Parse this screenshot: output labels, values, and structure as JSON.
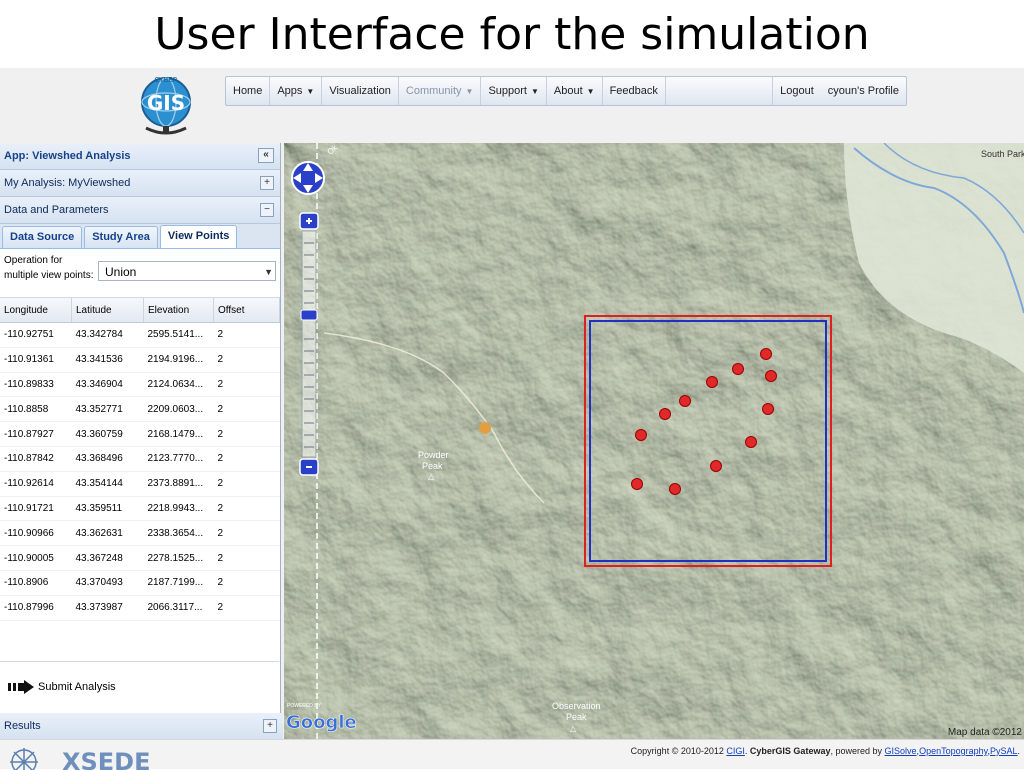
{
  "slide": {
    "title": "User Interface for the simulation"
  },
  "logo": {
    "text": "GIS",
    "arc_text": "CYBER"
  },
  "navbar": {
    "items": [
      {
        "label": "Home",
        "dropdown": false,
        "muted": false
      },
      {
        "label": "Apps",
        "dropdown": true,
        "muted": false
      },
      {
        "label": "Visualization",
        "dropdown": false,
        "muted": false
      },
      {
        "label": "Community",
        "dropdown": true,
        "muted": true
      },
      {
        "label": "Support",
        "dropdown": true,
        "muted": false
      },
      {
        "label": "About",
        "dropdown": true,
        "muted": false
      },
      {
        "label": "Feedback",
        "dropdown": false,
        "muted": false
      }
    ],
    "logout": "Logout",
    "profile": "cyoun's Profile"
  },
  "panel": {
    "app_title": "App: Viewshed Analysis",
    "collapse_icon": "«",
    "my_analysis": "My Analysis: MyViewshed",
    "expand_icon": "+",
    "data_params": "Data and Parameters",
    "minus_icon": "−",
    "tabs": [
      {
        "label": "Data Source",
        "active": false
      },
      {
        "label": "Study Area",
        "active": false
      },
      {
        "label": "View Points",
        "active": true
      }
    ],
    "operation_label": "Operation for multiple view points:",
    "operation_value": "Union",
    "columns": [
      "Longitude",
      "Latitude",
      "Elevation",
      "Offset"
    ],
    "rows": [
      [
        "-110.92751",
        "43.342784",
        "2595.5141...",
        "2"
      ],
      [
        "-110.91361",
        "43.341536",
        "2194.9196...",
        "2"
      ],
      [
        "-110.89833",
        "43.346904",
        "2124.0634...",
        "2"
      ],
      [
        "-110.8858",
        "43.352771",
        "2209.0603...",
        "2"
      ],
      [
        "-110.87927",
        "43.360759",
        "2168.1479...",
        "2"
      ],
      [
        "-110.87842",
        "43.368496",
        "2123.7770...",
        "2"
      ],
      [
        "-110.92614",
        "43.354144",
        "2373.8891...",
        "2"
      ],
      [
        "-110.91721",
        "43.359511",
        "2218.9943...",
        "2"
      ],
      [
        "-110.90966",
        "43.362631",
        "2338.3654...",
        "2"
      ],
      [
        "-110.90005",
        "43.367248",
        "2278.1525...",
        "2"
      ],
      [
        "-110.8906",
        "43.370493",
        "2187.7199...",
        "2"
      ],
      [
        "-110.87996",
        "43.373987",
        "2066.3117...",
        "2"
      ]
    ],
    "submit": "Submit Analysis",
    "results": "Results"
  },
  "map": {
    "label_south_park": "South Park",
    "label_powder_peak_1": "Powder",
    "label_powder_peak_2": "Peak",
    "label_observation_1": "Observation",
    "label_observation_2": "Peak",
    "label_ok": "Ok",
    "google": "Google",
    "google_powered": "POWERED BY",
    "map_data": "Map data ©2012",
    "colors": {
      "terrain": "#a9b59a",
      "study_area": "#e02020",
      "bbox": "#2030c0",
      "points": "#e02a2a",
      "water": "#7fa8d8"
    }
  },
  "footer": {
    "copyright_prefix": "Copyright © 2010-2012",
    "cigi": "CIGI",
    "gateway": "CyberGIS Gateway",
    "powered": "powered by",
    "gisolve": "GISolve",
    "opentopo": "OpenTopography",
    "pysal": "PySAL",
    "xsede": "XSEDE"
  }
}
